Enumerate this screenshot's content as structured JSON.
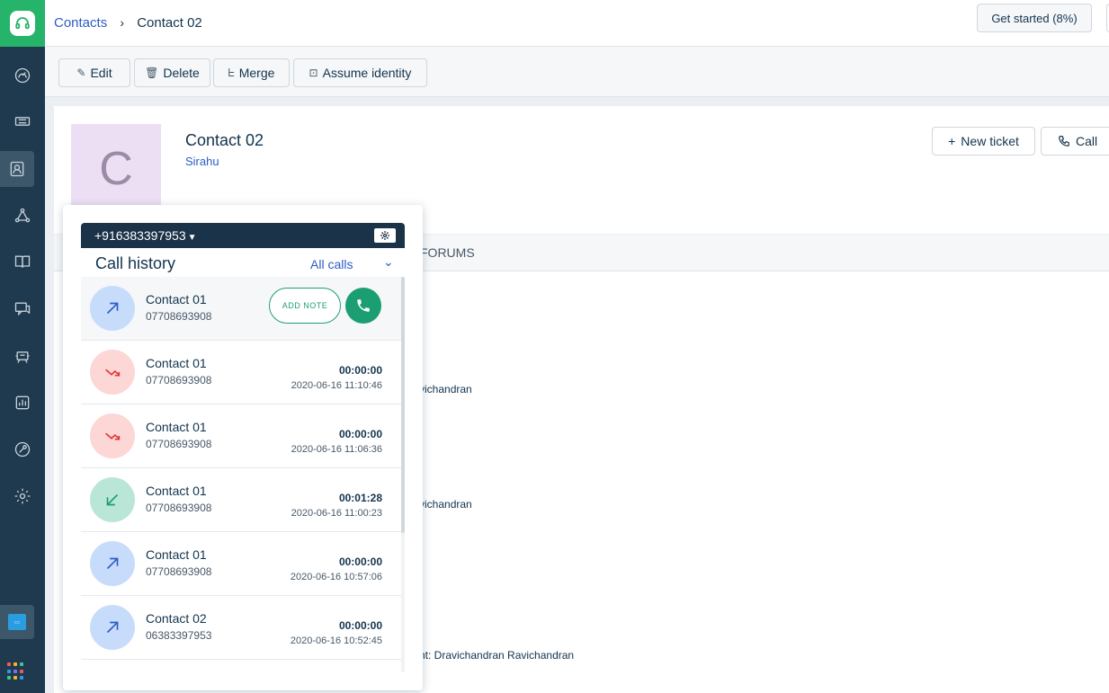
{
  "breadcrumb": {
    "parent": "Contacts",
    "separator": "›",
    "current": "Contact 02"
  },
  "topbar": {
    "get_started": "Get started (8%)"
  },
  "toolbar": {
    "edit": "Edit",
    "delete": "Delete",
    "merge": "Merge",
    "assume_identity": "Assume identity"
  },
  "contact": {
    "initial": "C",
    "name": "Contact 02",
    "company": "Sirahu"
  },
  "actions": {
    "new_ticket": "New ticket",
    "call": "Call"
  },
  "tabs": {
    "forums": "FORUMS"
  },
  "background_text": {
    "line1": "vichandran",
    "line2": "vichandran",
    "line3": "nt: Dravichandran Ravichandran"
  },
  "softphone": {
    "number": "+916383397953",
    "history_title": "Call history",
    "filter": "All calls",
    "add_note": "ADD NOTE",
    "calls": [
      {
        "type": "outgoing",
        "name": "Contact 01",
        "number": "07708693908",
        "duration": "",
        "time": ""
      },
      {
        "type": "missed",
        "name": "Contact 01",
        "number": "07708693908",
        "duration": "00:00:00",
        "time": "2020-06-16 11:10:46"
      },
      {
        "type": "missed",
        "name": "Contact 01",
        "number": "07708693908",
        "duration": "00:00:00",
        "time": "2020-06-16 11:06:36"
      },
      {
        "type": "incoming",
        "name": "Contact 01",
        "number": "07708693908",
        "duration": "00:01:28",
        "time": "2020-06-16 11:00:23"
      },
      {
        "type": "outgoing",
        "name": "Contact 01",
        "number": "07708693908",
        "duration": "00:00:00",
        "time": "2020-06-16 10:57:06"
      },
      {
        "type": "outgoing",
        "name": "Contact 02",
        "number": "06383397953",
        "duration": "00:00:00",
        "time": "2020-06-16 10:52:45"
      }
    ]
  },
  "colors": {
    "brand": "#26b36a",
    "sidebar": "#1f3a4f",
    "link": "#2c5cc5",
    "call_green": "#1a9e72"
  },
  "icons": [
    "headset-icon",
    "dashboard-icon",
    "ticket-icon",
    "contacts-icon",
    "network-icon",
    "book-icon",
    "chat-icon",
    "bot-icon",
    "reports-icon",
    "admin-icon",
    "settings-icon",
    "apps-icon"
  ]
}
